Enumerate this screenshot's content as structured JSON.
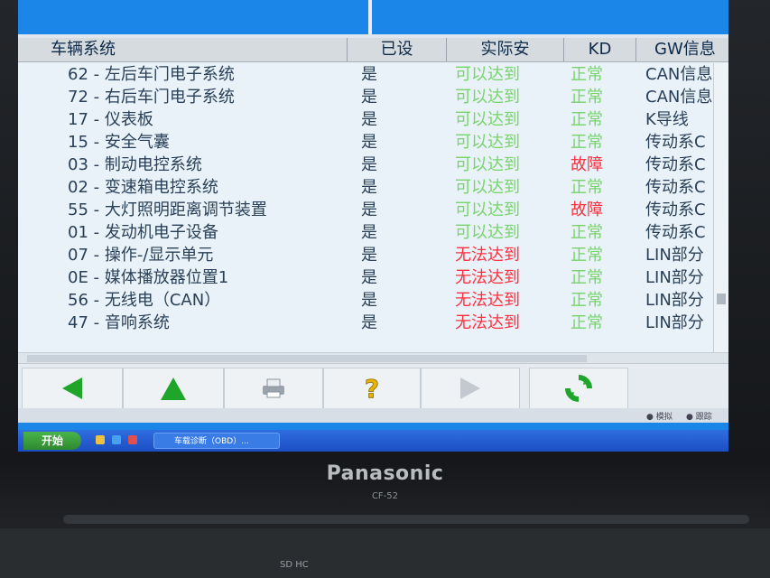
{
  "header": {
    "col_system": "车辆系统",
    "col_set": "已设",
    "col_actual": "实际安",
    "col_kd": "KD",
    "col_gw": "GW信息"
  },
  "rows": [
    {
      "name": "62 - 左后车门电子系统",
      "set": "是",
      "actual": "可以达到",
      "actual_status": "ok",
      "kd": "正常",
      "kd_status": "ok",
      "gw": "CAN信息"
    },
    {
      "name": "72 - 右后车门电子系统",
      "set": "是",
      "actual": "可以达到",
      "actual_status": "ok",
      "kd": "正常",
      "kd_status": "ok",
      "gw": "CAN信息"
    },
    {
      "name": "17 - 仪表板",
      "set": "是",
      "actual": "可以达到",
      "actual_status": "ok",
      "kd": "正常",
      "kd_status": "ok",
      "gw": "K导线"
    },
    {
      "name": "15 - 安全气囊",
      "set": "是",
      "actual": "可以达到",
      "actual_status": "ok",
      "kd": "正常",
      "kd_status": "ok",
      "gw": "传动系C"
    },
    {
      "name": "03 - 制动电控系统",
      "set": "是",
      "actual": "可以达到",
      "actual_status": "ok",
      "kd": "故障",
      "kd_status": "bad",
      "gw": "传动系C"
    },
    {
      "name": "02 - 变速箱电控系统",
      "set": "是",
      "actual": "可以达到",
      "actual_status": "ok",
      "kd": "正常",
      "kd_status": "ok",
      "gw": "传动系C"
    },
    {
      "name": "55 - 大灯照明距离调节装置",
      "set": "是",
      "actual": "可以达到",
      "actual_status": "ok",
      "kd": "故障",
      "kd_status": "bad",
      "gw": "传动系C"
    },
    {
      "name": "01 - 发动机电子设备",
      "set": "是",
      "actual": "可以达到",
      "actual_status": "ok",
      "kd": "正常",
      "kd_status": "ok",
      "gw": "传动系C"
    },
    {
      "name": "07 - 操作-/显示单元",
      "set": "是",
      "actual": "无法达到",
      "actual_status": "bad",
      "kd": "正常",
      "kd_status": "ok",
      "gw": "LIN部分"
    },
    {
      "name": "0E - 媒体播放器位置1",
      "set": "是",
      "actual": "无法达到",
      "actual_status": "bad",
      "kd": "正常",
      "kd_status": "ok",
      "gw": "LIN部分"
    },
    {
      "name": "56 - 无线电（CAN）",
      "set": "是",
      "actual": "无法达到",
      "actual_status": "bad",
      "kd": "正常",
      "kd_status": "ok",
      "gw": "LIN部分"
    },
    {
      "name": "47 - 音响系统",
      "set": "是",
      "actual": "无法达到",
      "actual_status": "bad",
      "kd": "正常",
      "kd_status": "ok",
      "gw": "LIN部分"
    }
  ],
  "toolbar": {
    "buttons": [
      {
        "icon": "arrow-left-icon"
      },
      {
        "icon": "arrow-up-icon"
      },
      {
        "icon": "printer-icon"
      },
      {
        "icon": "help-icon"
      },
      {
        "icon": "arrow-right-icon",
        "disabled": true
      },
      {
        "icon": "refresh-icon"
      }
    ]
  },
  "status": {
    "mode1": "模拟",
    "mode2": "跟踪"
  },
  "taskbar": {
    "start_label": "开始",
    "task_label": "车载诊断（OBD）..."
  },
  "device": {
    "brand": "Panasonic",
    "model": "CF-52",
    "sd_label": "SD HC"
  },
  "colors": {
    "ok": "#77d36b",
    "bad": "#ff2f3d",
    "accent": "#1b86e8"
  }
}
